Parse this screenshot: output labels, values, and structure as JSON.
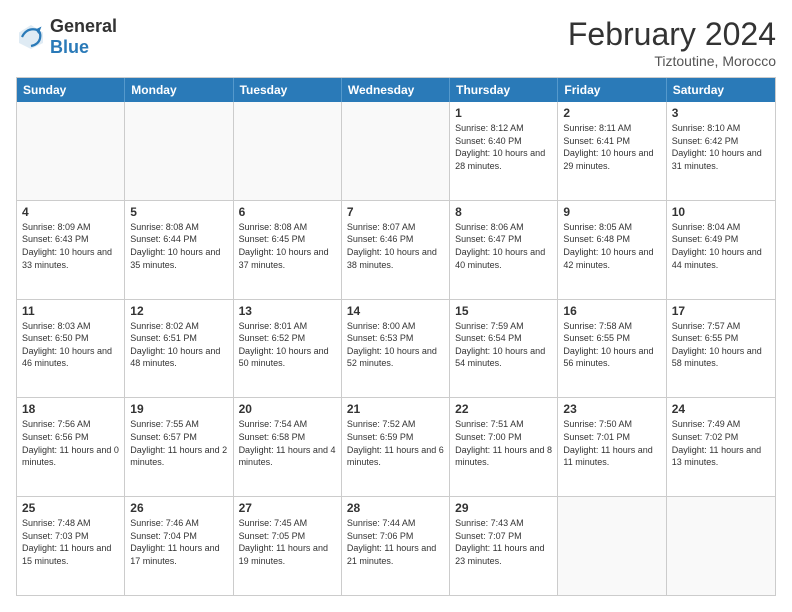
{
  "header": {
    "logo_general": "General",
    "logo_blue": "Blue",
    "month_title": "February 2024",
    "location": "Tiztoutine, Morocco"
  },
  "days_of_week": [
    "Sunday",
    "Monday",
    "Tuesday",
    "Wednesday",
    "Thursday",
    "Friday",
    "Saturday"
  ],
  "weeks": [
    [
      {
        "day": "",
        "info": ""
      },
      {
        "day": "",
        "info": ""
      },
      {
        "day": "",
        "info": ""
      },
      {
        "day": "",
        "info": ""
      },
      {
        "day": "1",
        "info": "Sunrise: 8:12 AM\nSunset: 6:40 PM\nDaylight: 10 hours and 28 minutes."
      },
      {
        "day": "2",
        "info": "Sunrise: 8:11 AM\nSunset: 6:41 PM\nDaylight: 10 hours and 29 minutes."
      },
      {
        "day": "3",
        "info": "Sunrise: 8:10 AM\nSunset: 6:42 PM\nDaylight: 10 hours and 31 minutes."
      }
    ],
    [
      {
        "day": "4",
        "info": "Sunrise: 8:09 AM\nSunset: 6:43 PM\nDaylight: 10 hours and 33 minutes."
      },
      {
        "day": "5",
        "info": "Sunrise: 8:08 AM\nSunset: 6:44 PM\nDaylight: 10 hours and 35 minutes."
      },
      {
        "day": "6",
        "info": "Sunrise: 8:08 AM\nSunset: 6:45 PM\nDaylight: 10 hours and 37 minutes."
      },
      {
        "day": "7",
        "info": "Sunrise: 8:07 AM\nSunset: 6:46 PM\nDaylight: 10 hours and 38 minutes."
      },
      {
        "day": "8",
        "info": "Sunrise: 8:06 AM\nSunset: 6:47 PM\nDaylight: 10 hours and 40 minutes."
      },
      {
        "day": "9",
        "info": "Sunrise: 8:05 AM\nSunset: 6:48 PM\nDaylight: 10 hours and 42 minutes."
      },
      {
        "day": "10",
        "info": "Sunrise: 8:04 AM\nSunset: 6:49 PM\nDaylight: 10 hours and 44 minutes."
      }
    ],
    [
      {
        "day": "11",
        "info": "Sunrise: 8:03 AM\nSunset: 6:50 PM\nDaylight: 10 hours and 46 minutes."
      },
      {
        "day": "12",
        "info": "Sunrise: 8:02 AM\nSunset: 6:51 PM\nDaylight: 10 hours and 48 minutes."
      },
      {
        "day": "13",
        "info": "Sunrise: 8:01 AM\nSunset: 6:52 PM\nDaylight: 10 hours and 50 minutes."
      },
      {
        "day": "14",
        "info": "Sunrise: 8:00 AM\nSunset: 6:53 PM\nDaylight: 10 hours and 52 minutes."
      },
      {
        "day": "15",
        "info": "Sunrise: 7:59 AM\nSunset: 6:54 PM\nDaylight: 10 hours and 54 minutes."
      },
      {
        "day": "16",
        "info": "Sunrise: 7:58 AM\nSunset: 6:55 PM\nDaylight: 10 hours and 56 minutes."
      },
      {
        "day": "17",
        "info": "Sunrise: 7:57 AM\nSunset: 6:55 PM\nDaylight: 10 hours and 58 minutes."
      }
    ],
    [
      {
        "day": "18",
        "info": "Sunrise: 7:56 AM\nSunset: 6:56 PM\nDaylight: 11 hours and 0 minutes."
      },
      {
        "day": "19",
        "info": "Sunrise: 7:55 AM\nSunset: 6:57 PM\nDaylight: 11 hours and 2 minutes."
      },
      {
        "day": "20",
        "info": "Sunrise: 7:54 AM\nSunset: 6:58 PM\nDaylight: 11 hours and 4 minutes."
      },
      {
        "day": "21",
        "info": "Sunrise: 7:52 AM\nSunset: 6:59 PM\nDaylight: 11 hours and 6 minutes."
      },
      {
        "day": "22",
        "info": "Sunrise: 7:51 AM\nSunset: 7:00 PM\nDaylight: 11 hours and 8 minutes."
      },
      {
        "day": "23",
        "info": "Sunrise: 7:50 AM\nSunset: 7:01 PM\nDaylight: 11 hours and 11 minutes."
      },
      {
        "day": "24",
        "info": "Sunrise: 7:49 AM\nSunset: 7:02 PM\nDaylight: 11 hours and 13 minutes."
      }
    ],
    [
      {
        "day": "25",
        "info": "Sunrise: 7:48 AM\nSunset: 7:03 PM\nDaylight: 11 hours and 15 minutes."
      },
      {
        "day": "26",
        "info": "Sunrise: 7:46 AM\nSunset: 7:04 PM\nDaylight: 11 hours and 17 minutes."
      },
      {
        "day": "27",
        "info": "Sunrise: 7:45 AM\nSunset: 7:05 PM\nDaylight: 11 hours and 19 minutes."
      },
      {
        "day": "28",
        "info": "Sunrise: 7:44 AM\nSunset: 7:06 PM\nDaylight: 11 hours and 21 minutes."
      },
      {
        "day": "29",
        "info": "Sunrise: 7:43 AM\nSunset: 7:07 PM\nDaylight: 11 hours and 23 minutes."
      },
      {
        "day": "",
        "info": ""
      },
      {
        "day": "",
        "info": ""
      }
    ]
  ]
}
